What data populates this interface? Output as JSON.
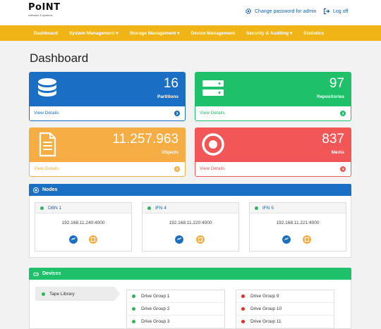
{
  "header": {
    "logo_text": "PoINT",
    "logo_sub": "software & systems",
    "change_password": "Change password for admin",
    "logout": "Log off"
  },
  "nav": {
    "items": [
      {
        "label": "Dashboard"
      },
      {
        "label": "System Management ▾"
      },
      {
        "label": "Storage Management ▾"
      },
      {
        "label": "Device Management"
      },
      {
        "label": "Security & Auditing ▾"
      },
      {
        "label": "Statistics"
      }
    ]
  },
  "page": {
    "title": "Dashboard"
  },
  "cards": [
    {
      "value": "16",
      "label": "Partitions",
      "link": "View Details",
      "color": "#1a6fc4",
      "icon": "database-icon"
    },
    {
      "value": "97",
      "label": "Repositories",
      "link": "View Details",
      "color": "#1fc06a",
      "icon": "server-icon"
    },
    {
      "value": "11.257.963",
      "label": "Objects",
      "link": "View Details",
      "color": "#f5ad44",
      "icon": "file-icon"
    },
    {
      "value": "837",
      "label": "Media",
      "link": "View Details",
      "color": "#f25656",
      "icon": "disc-icon"
    }
  ],
  "nodes_panel": {
    "title": "Nodes",
    "color": "#1a6fc4",
    "nodes": [
      {
        "name": "DBN 1",
        "ip": "192.168.11.240:4000"
      },
      {
        "name": "IFN 4",
        "ip": "192.168.11.220:4000"
      },
      {
        "name": "IFN 5",
        "ip": "192.168.11.221:4000"
      }
    ]
  },
  "devices_panel": {
    "title": "Devices",
    "color": "#1fc06a",
    "library": "Tape Library",
    "groups_left": [
      {
        "name": "Drive Group 1",
        "status": "#2cb65a"
      },
      {
        "name": "Drive Group 2",
        "status": "#2cb65a"
      },
      {
        "name": "Drive Group 3",
        "status": "#2cb65a"
      }
    ],
    "groups_right": [
      {
        "name": "Drive Group 9",
        "status": "#e0302a"
      },
      {
        "name": "Drive Group 10",
        "status": "#e0302a"
      },
      {
        "name": "Drive Group 11",
        "status": "#e0302a"
      }
    ]
  },
  "colors": {
    "nav": "#f0b417",
    "link": "#1a5fa8",
    "online": "#2cb65a",
    "offline": "#e0302a",
    "node_btn_blue": "#1a6fc4",
    "node_btn_orange": "#f5ad44"
  }
}
